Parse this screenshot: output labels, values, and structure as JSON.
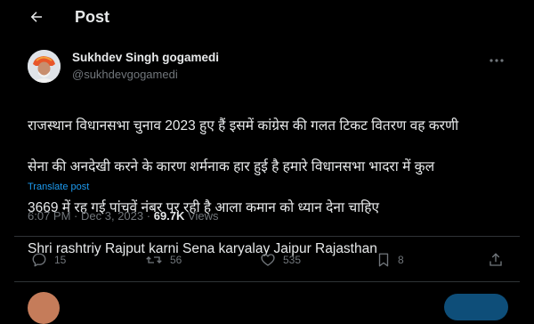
{
  "header": {
    "title": "Post"
  },
  "post": {
    "author_name": "Sukhdev Singh gogamedi",
    "author_handle": "@sukhdevgogamedi",
    "text_lines": [
      "राजस्थान विधानसभा चुनाव 2023 हुए हैं इसमें कांग्रेस की गलत टिकट  वितरण वह करणी",
      "सेना की अनदेखी करने के कारण शर्मनाक हार हुई है हमारे विधानसभा भादरा में कुल",
      "3669 में रह गई पांचवें नंबर पर रही है आला कमान को ध्यान देना चाहिए",
      "Shri rashtriy Rajput karni Sena karyalay Jaipur Rajasthan"
    ],
    "translate_label": "Translate post",
    "time": "6:07 PM",
    "date": "Dec 3, 2023",
    "separator": "·",
    "views_count": "69.7K",
    "views_label": "Views"
  },
  "actions": {
    "replies": "15",
    "reposts": "56",
    "likes": "535",
    "bookmarks": "8"
  },
  "colors": {
    "background": "#000000",
    "text": "#e7e9ea",
    "muted": "#71767b",
    "accent": "#1d9bf0",
    "divider": "#2f3336"
  },
  "icons": {
    "back": "arrow-left-icon",
    "more": "more-horizontal-icon",
    "reply": "speech-bubble-icon",
    "repost": "repost-arrows-icon",
    "like": "heart-icon",
    "bookmark": "bookmark-icon",
    "share": "share-upload-icon"
  }
}
